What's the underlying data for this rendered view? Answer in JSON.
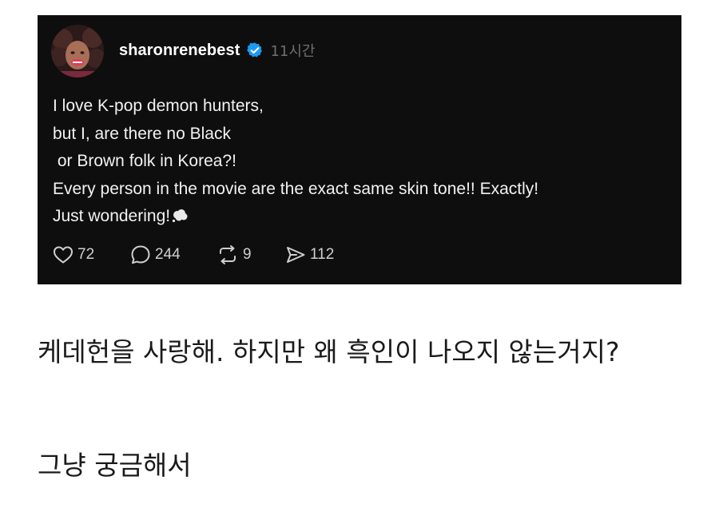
{
  "post": {
    "username": "sharonrenebest",
    "timestamp": "11시간",
    "lines": [
      "I love K-pop demon hunters,",
      "but I, are there no Black",
      " or Brown folk in Korea?!",
      "Every person in the movie are the exact same skin tone!! Exactly!",
      "Just wondering!"
    ],
    "stats": {
      "likes": "72",
      "replies": "244",
      "reposts": "9",
      "shares": "112"
    },
    "colors": {
      "background": "#0e0e0e",
      "verified": "#1d9bf0",
      "text": "#f2f2f2"
    }
  },
  "captions": {
    "line1": "케데헌을 사랑해. 하지만 왜 흑인이 나오지 않는거지?",
    "line2": "그냥 궁금해서"
  }
}
